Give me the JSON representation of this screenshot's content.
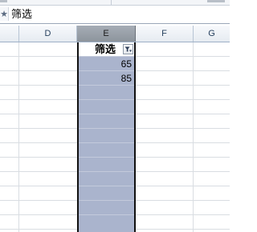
{
  "formula_bar": {
    "fx_icon": "function-icon",
    "content": "筛选"
  },
  "columns": [
    {
      "label": "",
      "selected": false
    },
    {
      "label": "D",
      "selected": false
    },
    {
      "label": "E",
      "selected": true
    },
    {
      "label": "F",
      "selected": false
    },
    {
      "label": "G",
      "selected": false
    }
  ],
  "selected_column": {
    "header_cell": "筛选",
    "filter_icon": "filter-dropdown-icon",
    "values": [
      "65",
      "85"
    ]
  },
  "colors": {
    "selection_fill": "#aab4cd",
    "selection_border": "#111111",
    "selected_header": "#9aa1a9"
  }
}
